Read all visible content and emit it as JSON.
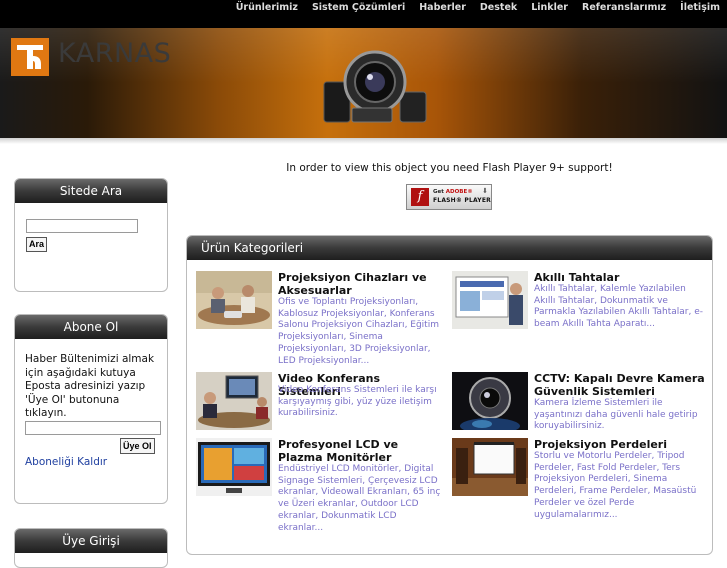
{
  "nav": {
    "items": [
      "Ürünlerimiz",
      "Sistem Çözümleri",
      "Haberler",
      "Destek",
      "Linkler",
      "Referanslarımız",
      "İletişim"
    ]
  },
  "brand": {
    "logo_letter": "T",
    "name": "KARNAS"
  },
  "colors": {
    "accent": "#e07812",
    "link": "#2040a0",
    "desc": "#7a70c8",
    "header_dark": "#1e1e1e"
  },
  "sidebar": {
    "search": {
      "title": "Sitede Ara",
      "input_value": "",
      "button_label": "Ara"
    },
    "subscribe": {
      "title": "Abone Ol",
      "text": "Haber Bültenimizi almak için aşağıdaki kutuya Eposta adresinizi yazıp 'Üye Ol' butonuna tıklayın.",
      "input_value": "",
      "button_label": "Üye Ol",
      "unsubscribe_label": "Aboneliği Kaldır"
    },
    "login": {
      "title": "Üye Girişi"
    }
  },
  "flash": {
    "message": "In order to view this object you need Flash Player 9+ support!",
    "badge_get": "Get",
    "badge_adobe": "ADOBE®",
    "badge_player": "FLASH® PLAYER"
  },
  "categories": {
    "title": "Ürün Kategorileri",
    "items": [
      {
        "title": "Projeksiyon Cihazları ve Aksesuarlar",
        "desc": "Ofis ve Toplantı Projeksiyonları, Kablosuz Projeksiyonlar, Konferans Salonu Projeksiyon Cihazları, Eğitim Projeksiyonları, Sinema Projeksiyonları, 3D Projeksiyonlar, LED Projeksiyonlar...",
        "image": "meeting-projector-photo"
      },
      {
        "title": "Akıllı Tahtalar",
        "desc": "Akıllı Tahtalar, Kalemle Yazılabilen Akıllı Tahtalar, Dokunmatik ve Parmakla Yazılabilen Akıllı Tahtalar, e-beam Akıllı Tahta Aparatı...",
        "image": "smartboard-photo"
      },
      {
        "title": "Video Konferans Sistemleri",
        "desc": "Video Konferans Sistemleri ile karşı karşıyaymış gibi, yüz yüze iletişim kurabilirsiniz.",
        "image": "video-conference-photo"
      },
      {
        "title": "CCTV: Kapalı Devre Kamera Güvenlik Sistemleri",
        "desc": "Kamera İzleme Sistemleri ile yaşantınızı daha güvenli hale getirip koruyabilirsiniz.",
        "image": "cctv-camera-photo"
      },
      {
        "title": "Profesyonel LCD ve Plazma Monitörler",
        "desc": "Endüstriyel LCD Monitörler, Digital Signage Sistemleri, Çerçevesiz LCD ekranlar, Videowall Ekranları, 65 inç ve Üzeri ekranlar, Outdoor LCD ekranlar, Dokunmatik LCD ekranlar...",
        "image": "lcd-monitor-photo"
      },
      {
        "title": "Projeksiyon Perdeleri",
        "desc": "Storlu ve Motorlu Perdeler, Tripod Perdeler, Fast Fold Perdeler, Ters Projeksiyon Perdeleri, Sinema Perdeleri, Frame Perdeler, Masaüstü Perdeler ve özel Perde uygulamalarımız...",
        "image": "projection-screen-photo"
      }
    ]
  }
}
